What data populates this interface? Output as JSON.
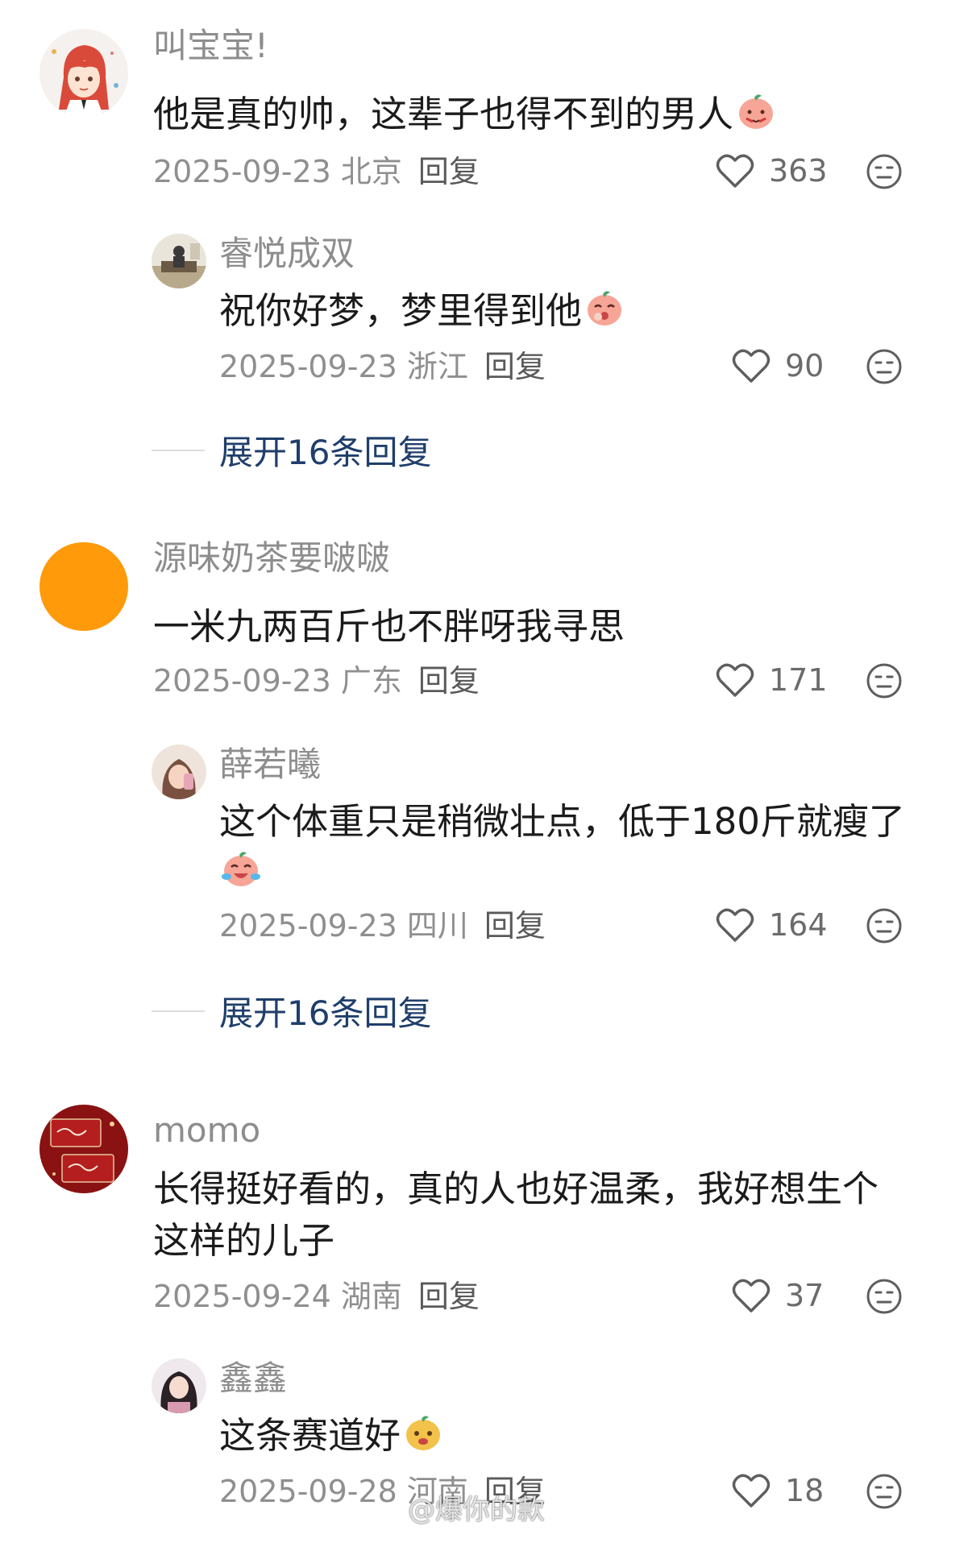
{
  "comments": [
    {
      "username": "叫宝宝!",
      "text": "他是真的帅，这辈子也得不到的男人",
      "date_location": "2025-09-23 北京",
      "reply_label": "回复",
      "likes": "363",
      "avatar": "anime-girl-avatar",
      "emoji": "peach-shy-emoji"
    },
    {
      "username": "睿悦成双",
      "text": "祝你好梦，梦里得到他",
      "date_location": "2025-09-23 浙江",
      "reply_label": "回复",
      "likes": "90",
      "avatar": "room-photo-avatar",
      "emoji": "peach-giggle-emoji"
    },
    {
      "username": "源味奶茶要啵啵",
      "text": "一米九两百斤也不胖呀我寻思",
      "date_location": "2025-09-23 广东",
      "reply_label": "回复",
      "likes": "171",
      "avatar": "orange-circle-avatar",
      "avatar_color": "#FF9A0A"
    },
    {
      "username": "薛若曦",
      "text_line1": "这个体重只是稍微壮点，低于180斤就瘦了",
      "date_location": "2025-09-23 四川",
      "reply_label": "回复",
      "likes": "164",
      "avatar": "selfie-photo-avatar",
      "emoji": "peach-crying-laugh-emoji"
    },
    {
      "username": "momo",
      "text_line1": "长得挺好看的，真的人也好温柔，我好想生个",
      "text_line2": "这样的儿子",
      "date_location": "2025-09-24 湖南",
      "reply_label": "回复",
      "likes": "37",
      "avatar": "red-greeting-card-avatar"
    },
    {
      "username": "鑫鑫",
      "text": "这条赛道好",
      "date_location": "2025-09-28 河南",
      "reply_label": "回复",
      "likes": "18",
      "avatar": "portrait-photo-avatar",
      "emoji": "dog-sly-emoji"
    }
  ],
  "expand_replies": [
    {
      "label": "展开16条回复"
    },
    {
      "label": "展开16条回复"
    }
  ],
  "watermark": "@爆你的款",
  "colors": {
    "username": "#8d8d8d",
    "content": "#1b1b1b",
    "meta": "#8f8f8f",
    "expand_link": "#1f3e6b",
    "background": "#ffffff"
  },
  "icons": {
    "like": "heart-outline-icon",
    "dislike": "neutral-face-icon"
  }
}
